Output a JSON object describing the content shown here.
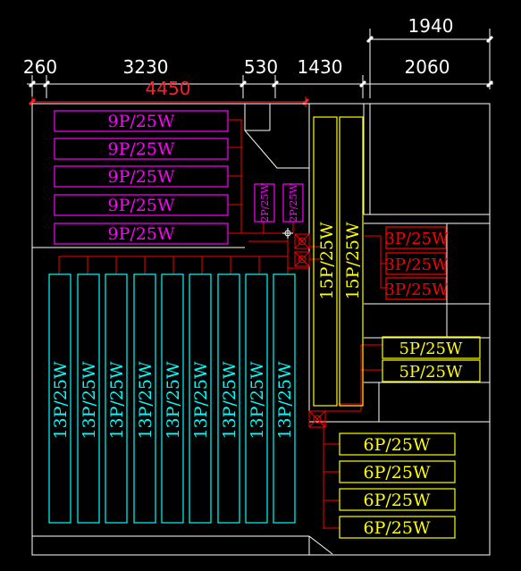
{
  "colors": {
    "background": "#000000",
    "wall": "#ffffff",
    "magenta": "#ff00ff",
    "cyan": "#00ffff",
    "yellow": "#ffff00",
    "red": "#ff0000",
    "dimension": "#ffffff",
    "dimension_total": "#ff2020"
  },
  "dimensions": {
    "top_right": "1940",
    "segments": [
      "260",
      "3230",
      "530",
      "1430",
      "2060"
    ],
    "total": "4450"
  },
  "groups": {
    "magenta_rows": [
      "9P/25W",
      "9P/25W",
      "9P/25W",
      "9P/25W",
      "9P/25W"
    ],
    "magenta_small": [
      "2P/25W",
      "2P/25W"
    ],
    "cyan_columns": [
      "13P/25W",
      "13P/25W",
      "13P/25W",
      "13P/25W",
      "13P/25W",
      "13P/25W",
      "13P/25W",
      "13P/25W",
      "13P/25W"
    ],
    "yellow_tall": [
      "15P/25W",
      "15P/25W"
    ],
    "red_right": [
      "3P/25W",
      "3P/25W",
      "3P/25W"
    ],
    "yellow_right": [
      "5P/25W",
      "5P/25W"
    ],
    "yellow_bottom": [
      "6P/25W",
      "6P/25W",
      "6P/25W",
      "6P/25W"
    ]
  }
}
